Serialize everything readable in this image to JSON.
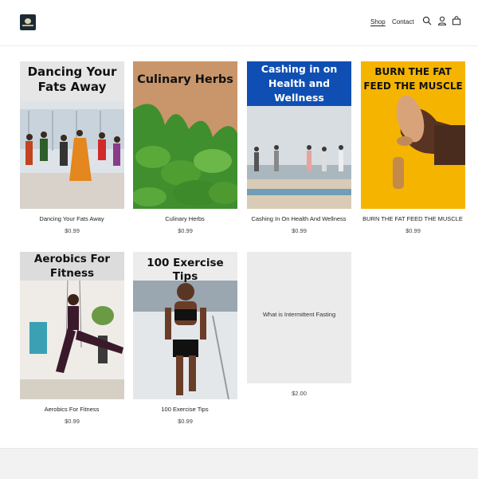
{
  "header": {
    "nav": {
      "shop": "Shop",
      "contact": "Contact"
    },
    "icons": [
      "search-icon",
      "account-icon",
      "cart-icon"
    ]
  },
  "products": [
    {
      "image_title": "Dancing Your Fats Away",
      "name": "Dancing Your Fats Away",
      "price": "$0.99"
    },
    {
      "image_title": "Culinary Herbs",
      "name": "Culinary Herbs",
      "price": "$0.99"
    },
    {
      "image_title": "Cashing in on Health and Wellness",
      "name": "Cashing In On Health And Wellness",
      "price": "$0.99"
    },
    {
      "image_title": "BURN THE FAT FEED THE MUSCLE",
      "name": "BURN THE FAT FEED THE MUSCLE",
      "price": "$0.99"
    },
    {
      "image_title": "Aerobics For Fitness",
      "name": "Aerobics For Fitness",
      "price": "$0.99"
    },
    {
      "image_title": "100 Exercise Tips",
      "name": "100 Exercise Tips",
      "price": "$0.99"
    },
    {
      "image_title": "",
      "placeholder": "What is Intermittent Fasting",
      "price": "$2.00"
    }
  ],
  "colors": {
    "blue_banner": "#0f4fb3",
    "yellow_bg": "#f5b400",
    "tan_bg": "#c9956a"
  }
}
